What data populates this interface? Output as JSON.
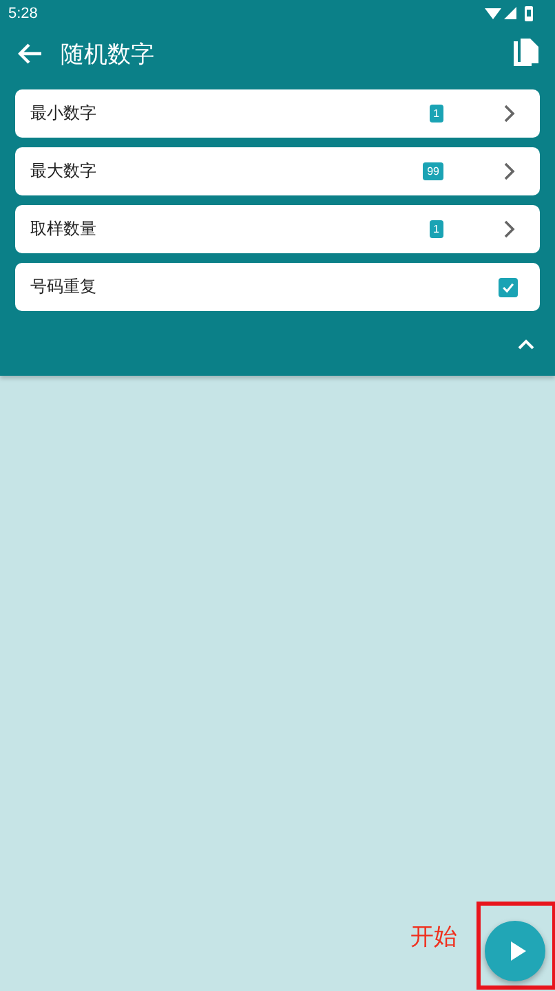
{
  "status_bar": {
    "time": "5:28"
  },
  "toolbar": {
    "title": "随机数字"
  },
  "settings": [
    {
      "kind": "value",
      "label": "最小数字",
      "value": "1"
    },
    {
      "kind": "value",
      "label": "最大数字",
      "value": "99"
    },
    {
      "kind": "value",
      "label": "取样数量",
      "value": "1"
    },
    {
      "kind": "checkbox",
      "label": "号码重复",
      "checked": true
    }
  ],
  "panel": {
    "expanded": true
  },
  "annotation": {
    "label": "开始"
  }
}
